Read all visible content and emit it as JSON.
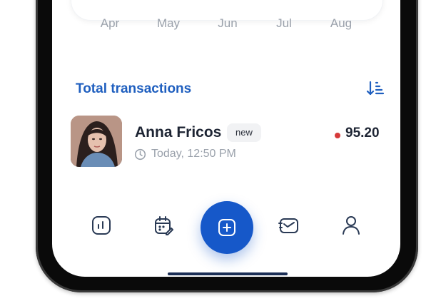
{
  "chart": {
    "months": [
      "Apr",
      "May",
      "Jun",
      "Jul",
      "Aug"
    ],
    "line_color": "#2db83d"
  },
  "transactions": {
    "title": "Total transactions",
    "sort_icon": "sort-descending-icon",
    "items": [
      {
        "name": "Anna Fricos",
        "badge": "new",
        "time": "Today, 12:50 PM",
        "amount": "95.20",
        "status_color": "#d63a3a",
        "avatar": "avatar-photo"
      }
    ]
  },
  "nav": {
    "items": [
      {
        "icon": "analytics-icon"
      },
      {
        "icon": "calendar-edit-icon"
      },
      {
        "icon": "add-icon"
      },
      {
        "icon": "messages-icon"
      },
      {
        "icon": "profile-icon"
      }
    ],
    "accent": "#1658c9"
  }
}
